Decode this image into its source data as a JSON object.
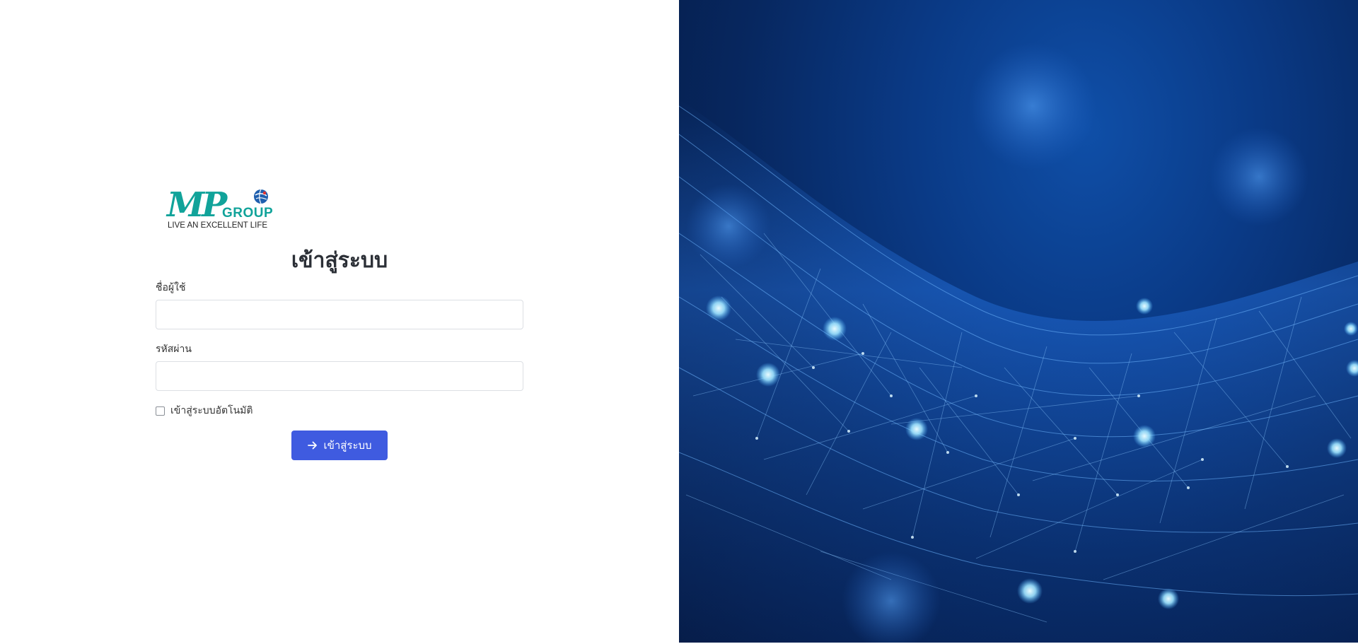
{
  "brand": {
    "wordmark": "MP",
    "group_text": "GROUP",
    "tagline": "LIVE AN EXCELLENT LIFE",
    "color": "#11a39a"
  },
  "login": {
    "title": "เข้าสู่ระบบ",
    "username_label": "ชื่อผู้ใช้",
    "username_value": "",
    "password_label": "รหัสผ่าน",
    "password_value": "",
    "remember_label": "เข้าสู่ระบบอัตโนมัติ",
    "remember_checked": false,
    "submit_label": "เข้าสู่ระบบ",
    "submit_icon": "arrow-right-icon",
    "button_color": "#3f5be0"
  },
  "background": {
    "image": "blue-network-mesh",
    "colors": [
      "#05173d",
      "#0a3a86",
      "#1e6fe0",
      "#bfe8ff"
    ]
  }
}
